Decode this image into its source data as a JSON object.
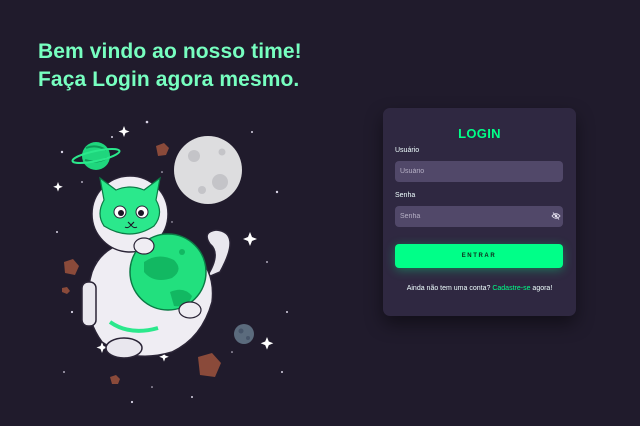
{
  "hero": {
    "line1": "Bem vindo ao nosso time!",
    "line2": "Faça Login agora mesmo."
  },
  "login": {
    "title": "LOGIN",
    "username_label": "Usuário",
    "username_placeholder": "Usuário",
    "password_label": "Senha",
    "password_placeholder": "Senha",
    "password_toggle_icon": "eye-slash-icon",
    "submit_label": "ENTRAR",
    "signup_prompt": "Ainda não tem uma conta?",
    "signup_link": "Cadastre-se",
    "signup_suffix": "agora!"
  },
  "colors": {
    "background": "#201b2c",
    "card": "#2f2841",
    "input": "#514869",
    "accent": "#00ff88",
    "headline": "#77ffc0"
  }
}
